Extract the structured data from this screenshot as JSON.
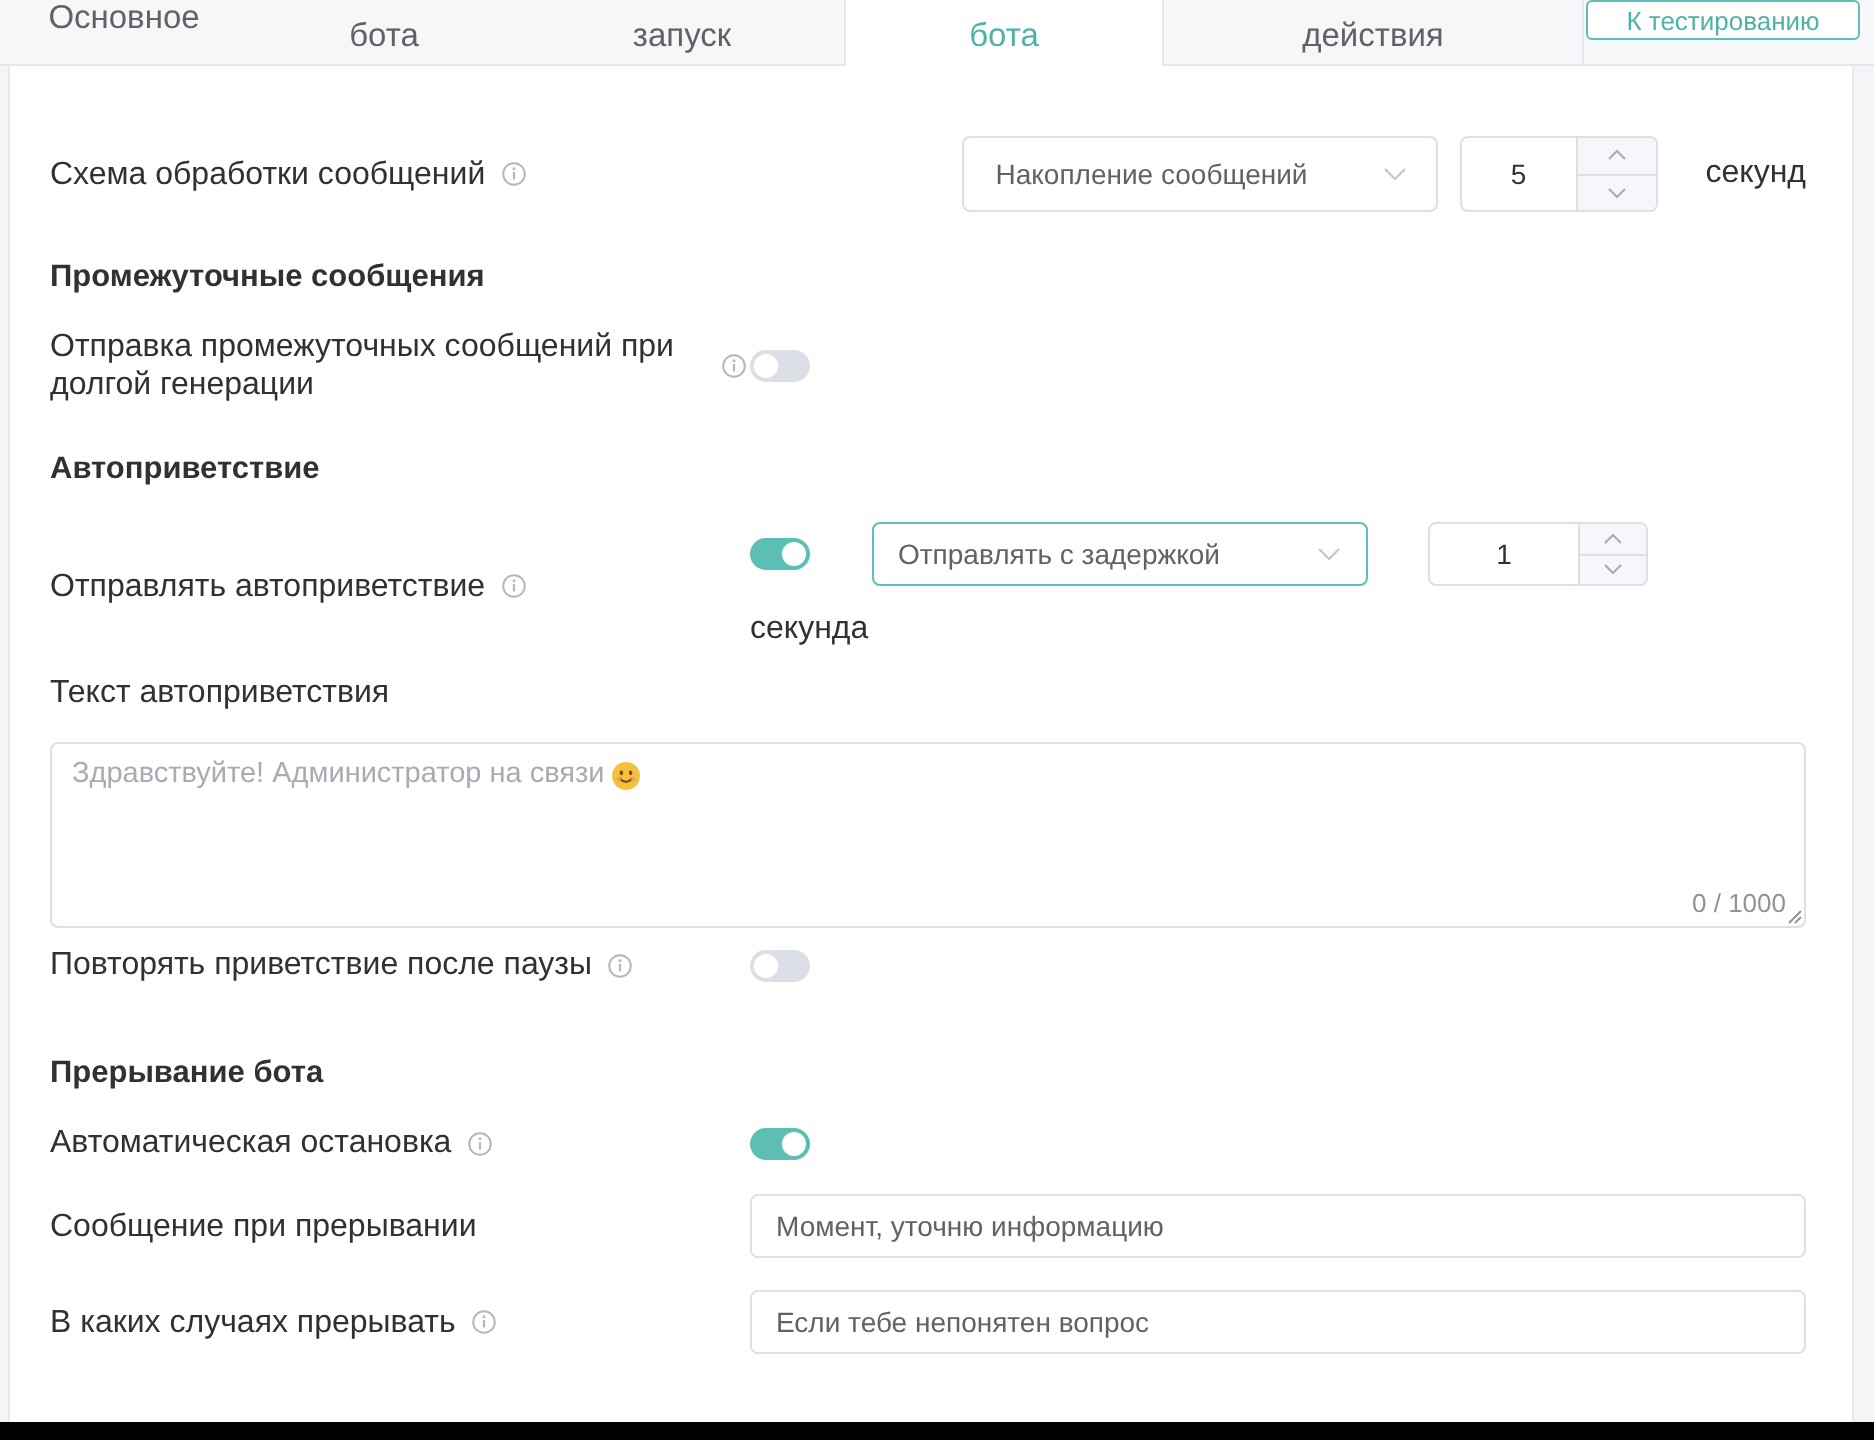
{
  "tabs": [
    {
      "label": "Основное",
      "selected": false
    },
    {
      "label": "бота",
      "selected": false
    },
    {
      "label": "запуск",
      "selected": false
    },
    {
      "label": "бота",
      "selected": true
    },
    {
      "label": "действия",
      "selected": false
    }
  ],
  "test_button": {
    "label": "К тестированию"
  },
  "rows": [
    {
      "kind": "select_number",
      "label": "Схема обработки сообщений",
      "info": true,
      "select": {
        "value": "Накопление сообщений",
        "focused": false
      },
      "number": {
        "value": "5"
      },
      "unit": "секунд"
    },
    {
      "kind": "heading",
      "label": "Промежуточные сообщения"
    },
    {
      "kind": "toggle",
      "label": "Отправка промежуточных сообщений при долгой генерации",
      "info": true,
      "on": false
    },
    {
      "kind": "heading",
      "label": "Автоприветствие"
    },
    {
      "kind": "toggle_select_number",
      "label": "Отправлять автоприветствие",
      "info": true,
      "on": true,
      "select": {
        "value": "Отправлять с задержкой",
        "focused": true
      },
      "number": {
        "value": "1"
      },
      "unit": "секунда"
    },
    {
      "kind": "label",
      "label": "Текст автоприветствия"
    },
    {
      "kind": "textarea",
      "placeholder": "Здравствуйте! Администратор на связи",
      "counter": "0 / 1000"
    },
    {
      "kind": "toggle",
      "label": "Повторять приветствие после паузы",
      "info": true,
      "on": false
    },
    {
      "kind": "heading",
      "label": "Прерывание бота"
    },
    {
      "kind": "toggle",
      "label": "Автоматическая остановка",
      "info": true,
      "on": true
    },
    {
      "kind": "input",
      "label": "Сообщение при прерывании",
      "info": false,
      "value": "Момент, уточню информацию"
    },
    {
      "kind": "input",
      "label": "В каких случаях прерывать",
      "info": true,
      "value": "Если тебе непонятен вопрос"
    }
  ]
}
